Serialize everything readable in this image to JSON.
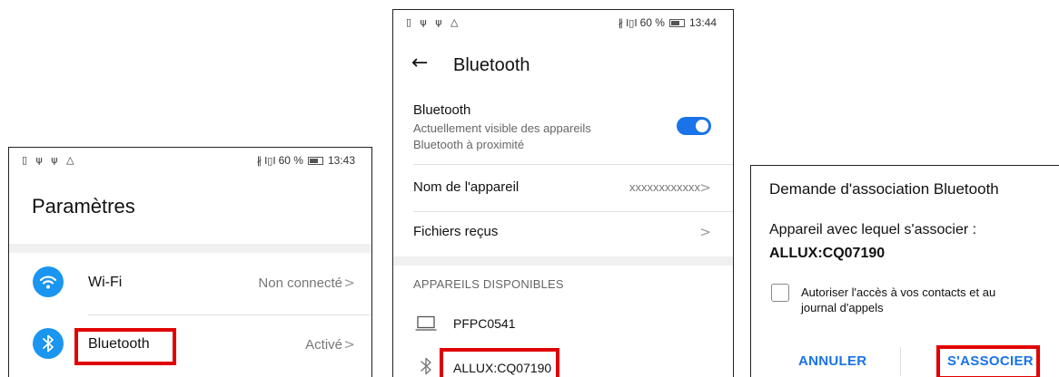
{
  "statusbar": {
    "left_icons": "▯ ψ ψ △",
    "bluetooth_glyph": "∦",
    "signal": "I▯I",
    "battery_pct": "60 %",
    "time_panel1": "13:43",
    "time_panel2": "13:44"
  },
  "settings": {
    "title": "Paramètres",
    "items": [
      {
        "label": "Wi-Fi",
        "value": "Non connecté",
        "icon": "wifi-icon"
      },
      {
        "label": "Bluetooth",
        "value": "Activé",
        "icon": "bluetooth-icon"
      }
    ],
    "chevron": ">"
  },
  "bluetooth_screen": {
    "back_arrow": "←",
    "title": "Bluetooth",
    "toggle": {
      "label": "Bluetooth",
      "description_line1": "Actuellement visible des appareils",
      "description_line2": "Bluetooth à proximité",
      "on": true
    },
    "device_name": {
      "label": "Nom de l'appareil",
      "value": "xxxxxxxxxxxx"
    },
    "received_files": {
      "label": "Fichiers reçus"
    },
    "available_header": "APPAREILS DISPONIBLES",
    "devices": [
      {
        "name": "PFPC0541",
        "icon": "laptop-icon"
      },
      {
        "name": "ALLUX:CQ07190",
        "icon": "bluetooth-icon"
      }
    ],
    "chevron": ">"
  },
  "pairing_dialog": {
    "title": "Demande d'association Bluetooth",
    "prompt": "Appareil avec lequel s'associer :",
    "device": "ALLUX:CQ07190",
    "checkbox_line1": "Autoriser l'accès à vos contacts et au",
    "checkbox_line2": "journal d'appels",
    "checkbox_checked": false,
    "cancel_label": "ANNULER",
    "pair_label": "S'ASSOCIER"
  },
  "colors": {
    "accent": "#1a73e8",
    "icon_blue": "#1a95f0",
    "highlight": "#e10000"
  }
}
